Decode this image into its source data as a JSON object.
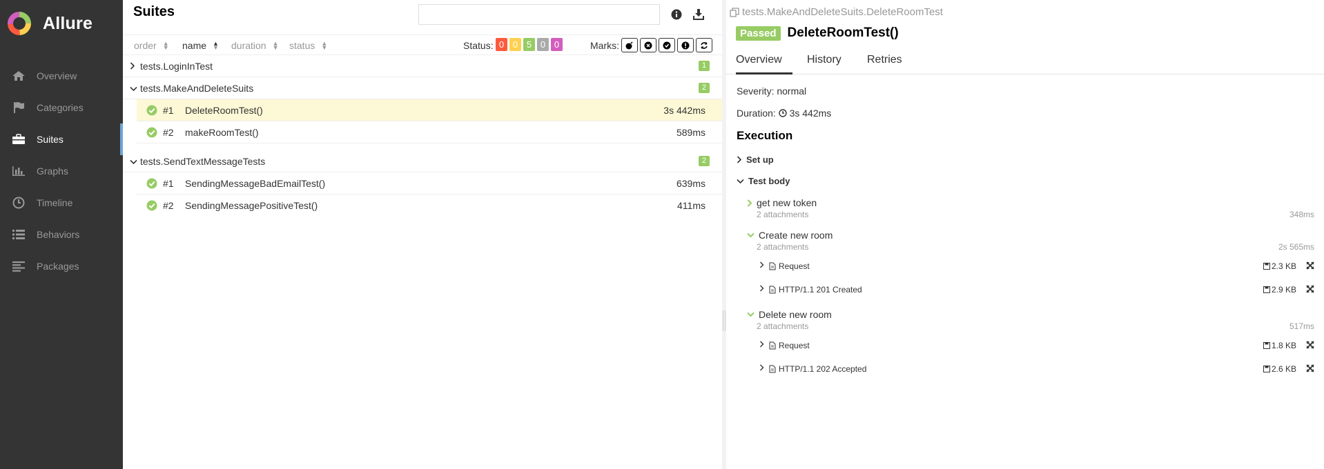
{
  "app": {
    "name": "Allure"
  },
  "sidebar": {
    "items": [
      {
        "label": "Overview",
        "icon": "home-icon"
      },
      {
        "label": "Categories",
        "icon": "flag-icon"
      },
      {
        "label": "Suites",
        "icon": "briefcase-icon",
        "active": true
      },
      {
        "label": "Graphs",
        "icon": "bar-chart-icon"
      },
      {
        "label": "Timeline",
        "icon": "clock-icon"
      },
      {
        "label": "Behaviors",
        "icon": "list-icon"
      },
      {
        "label": "Packages",
        "icon": "align-left-icon"
      }
    ]
  },
  "suites": {
    "title": "Suites",
    "search": {
      "value": "",
      "placeholder": ""
    },
    "sort": {
      "order": "order",
      "name": "name",
      "duration": "duration",
      "status": "status"
    },
    "status_label": "Status:",
    "status_counts": [
      {
        "value": "0",
        "color": "#fd5a3e"
      },
      {
        "value": "0",
        "color": "#ffd050"
      },
      {
        "value": "5",
        "color": "#97cc64"
      },
      {
        "value": "0",
        "color": "#aaaaaa"
      },
      {
        "value": "0",
        "color": "#d35ebe"
      }
    ],
    "marks_label": "Marks:",
    "groups": [
      {
        "name": "tests.LoginInTest",
        "count": "1",
        "expanded": false,
        "tests": []
      },
      {
        "name": "tests.MakeAndDeleteSuits",
        "count": "2",
        "expanded": true,
        "tests": [
          {
            "num": "#1",
            "name": "DeleteRoomTest()",
            "duration": "3s 442ms",
            "selected": true
          },
          {
            "num": "#2",
            "name": "makeRoomTest()",
            "duration": "589ms"
          }
        ]
      },
      {
        "name": "tests.SendTextMessageTests",
        "count": "2",
        "expanded": true,
        "tests": [
          {
            "num": "#1",
            "name": "SendingMessageBadEmailTest()",
            "duration": "639ms"
          },
          {
            "num": "#2",
            "name": "SendingMessagePositiveTest()",
            "duration": "411ms"
          }
        ]
      }
    ]
  },
  "detail": {
    "path": "tests.MakeAndDeleteSuits.DeleteRoomTest",
    "status": "Passed",
    "name": "DeleteRoomTest()",
    "tabs": [
      "Overview",
      "History",
      "Retries"
    ],
    "severity_label": "Severity:",
    "severity": "normal",
    "duration_label": "Duration:",
    "duration": "3s 442ms",
    "execution_title": "Execution",
    "setup_label": "Set up",
    "body_label": "Test body",
    "steps": [
      {
        "name": "get new token",
        "attachments": "2 attachments",
        "duration": "348ms",
        "expanded": false,
        "items": []
      },
      {
        "name": "Create new room",
        "attachments": "2 attachments",
        "duration": "2s 565ms",
        "expanded": true,
        "items": [
          {
            "name": "Request",
            "size": "2.3 KB"
          },
          {
            "name": "HTTP/1.1 201 Created",
            "size": "2.9 KB"
          }
        ]
      },
      {
        "name": "Delete new room",
        "attachments": "2 attachments",
        "duration": "517ms",
        "expanded": true,
        "items": [
          {
            "name": "Request",
            "size": "1.8 KB"
          },
          {
            "name": "HTTP/1.1 202 Accepted",
            "size": "2.6 KB"
          }
        ]
      }
    ]
  },
  "colors": {
    "sidebar_bg": "#343434",
    "passed": "#97cc64",
    "selected_row": "#fdf8d6",
    "active_nav_marker": "#6ea5d6"
  }
}
